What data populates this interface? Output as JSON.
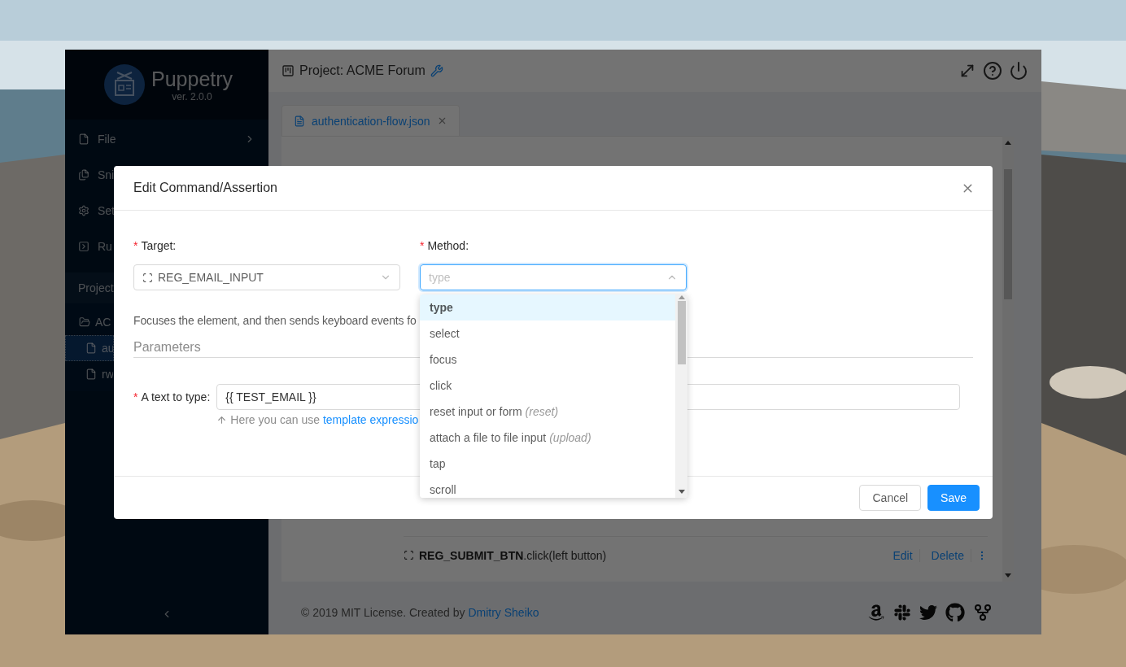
{
  "sidebar": {
    "app_name": "Puppetry",
    "version": "ver. 2.0.0",
    "menu": [
      {
        "label": "File",
        "submenu": true
      },
      {
        "label": "Sni"
      },
      {
        "label": "Set"
      },
      {
        "label": "Ru"
      }
    ],
    "project_heading": "Project",
    "tree": [
      {
        "label": "AC",
        "expanded": true,
        "children": [
          {
            "label": "au",
            "selected": true
          },
          {
            "label": "rw",
            "selected": false
          }
        ]
      }
    ]
  },
  "header": {
    "title": "Project: ACME Forum"
  },
  "tabs": [
    {
      "label": "authentication-flow.json",
      "selected": true
    }
  ],
  "commands": [
    {
      "text": "**REG_SUBMIT_BTN**.click(left button)",
      "actions": [
        "Edit",
        "Delete"
      ]
    }
  ],
  "footer": {
    "text": "© 2019 MIT License. Created by ",
    "link": "Dmitry Sheiko"
  },
  "modal": {
    "title": "Edit Command/Assertion",
    "target": {
      "mark": "*",
      "label": "Target:",
      "value": "REG_EMAIL_INPUT"
    },
    "method": {
      "mark": "*",
      "label": "Method:",
      "placeholder": "type",
      "options": [
        {
          "label": "type",
          "selected": true
        },
        {
          "label": "select",
          "selected": false
        },
        {
          "label": "focus",
          "selected": false
        },
        {
          "label": "click",
          "selected": false
        },
        {
          "label": "reset input or form",
          "alias": "(reset)",
          "selected": false
        },
        {
          "label": "attach a file to file input",
          "alias": "(upload)",
          "selected": false
        },
        {
          "label": "tap",
          "selected": false
        },
        {
          "label": "scroll",
          "selected": false
        }
      ]
    },
    "description": "Focuses the element, and then sends keyboard events fo",
    "section": "Parameters",
    "param": {
      "mark": "*",
      "label": "A text to type:",
      "value": "{{ TEST_EMAIL }}",
      "hint": "Here you can use ",
      "hint_link": "template expressio"
    },
    "buttons": [
      "Cancel",
      "Save"
    ]
  }
}
